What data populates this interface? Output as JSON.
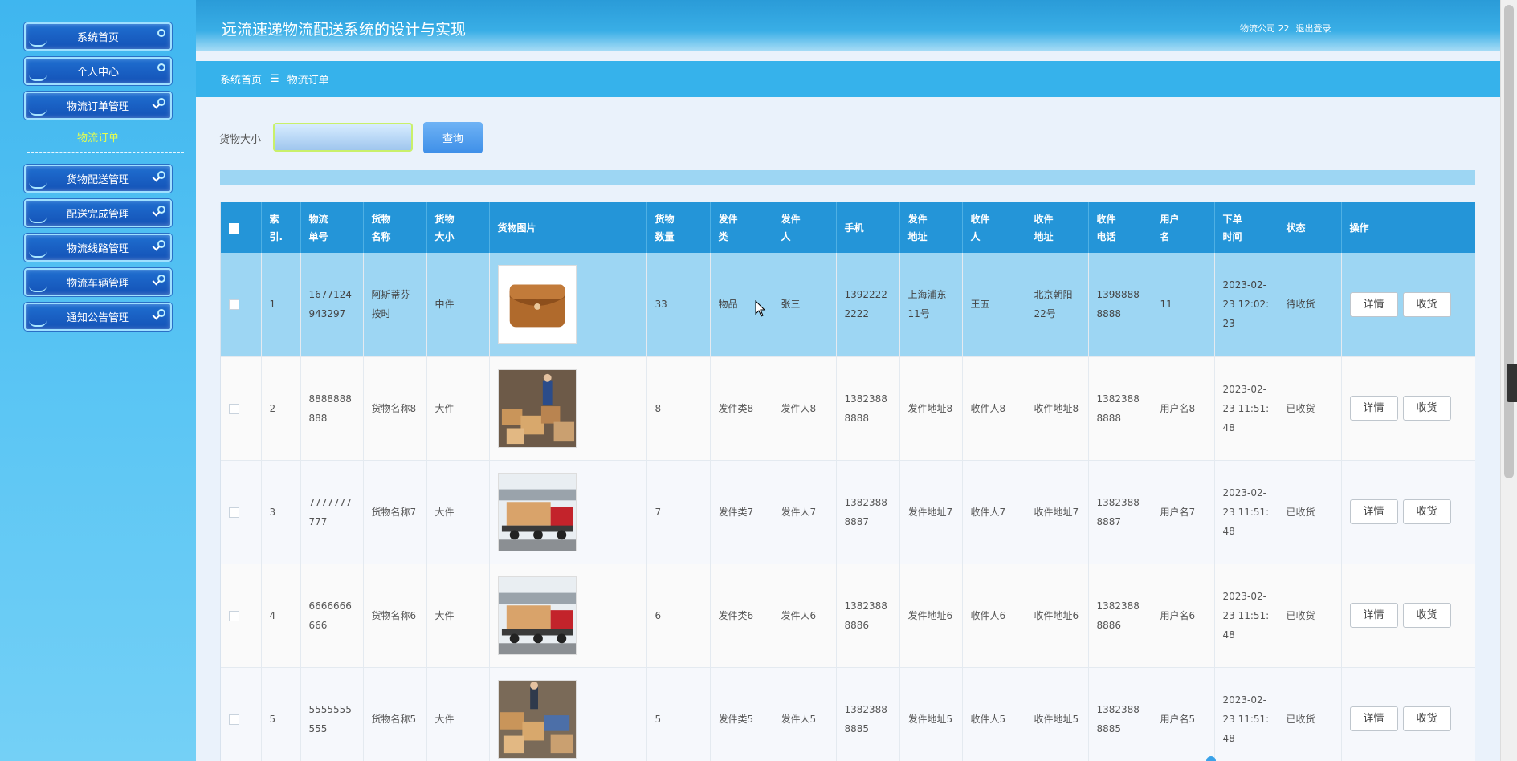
{
  "sidebar": {
    "items": [
      {
        "label": "系统首页"
      },
      {
        "label": "个人中心"
      },
      {
        "label": "物流订单管理"
      },
      {
        "label": "货物配送管理"
      },
      {
        "label": "配送完成管理"
      },
      {
        "label": "物流线路管理"
      },
      {
        "label": "物流车辆管理"
      },
      {
        "label": "通知公告管理"
      }
    ],
    "active_submenu": "物流订单"
  },
  "header": {
    "title": "远流速递物流配送系统的设计与实现",
    "user": "物流公司 22",
    "logout": "退出登录"
  },
  "breadcrumb": {
    "home": "系统首页",
    "separator": "☰",
    "current": "物流订单"
  },
  "search": {
    "label": "货物大小",
    "value": "",
    "button": "查询"
  },
  "table": {
    "headers": [
      "索引",
      "物流单号",
      "货物名称",
      "货物大小",
      "货物图片",
      "货物数量",
      "发件类",
      "发件人",
      "手机",
      "发件地址",
      "收件人",
      "收件地址",
      "收件电话",
      "用户名",
      "下单时间",
      "状态",
      "操作"
    ],
    "header_lines": [
      [
        "索",
        "引."
      ],
      [
        "物流",
        "单号"
      ],
      [
        "货物",
        "名称"
      ],
      [
        "货物",
        "大小"
      ],
      [
        "货物图片"
      ],
      [
        "货物",
        "数量"
      ],
      [
        "发件",
        "类"
      ],
      [
        "发件",
        "人"
      ],
      [
        "手机"
      ],
      [
        "发件",
        "地址"
      ],
      [
        "收件",
        "人"
      ],
      [
        "收件",
        "地址"
      ],
      [
        "收件",
        "电话"
      ],
      [
        "用户",
        "名"
      ],
      [
        "下单",
        "时间"
      ],
      [
        "状态"
      ],
      [
        "操作"
      ]
    ],
    "detail_label": "详情",
    "receive_label": "收货",
    "rows": [
      {
        "index": "1",
        "order_no": "1677124943297",
        "name": "阿斯蒂芬按时",
        "size": "中件",
        "image": "bag-photo",
        "qty": "33",
        "type": "物品",
        "sender": "张三",
        "phone": "13922222222",
        "send_addr": "上海浦东11号",
        "receiver": "王五",
        "recv_addr": "北京朝阳22号",
        "recv_phone": "13988888888",
        "username": "11",
        "time": "2023-02-23 12:02:23",
        "status": "待收货"
      },
      {
        "index": "2",
        "order_no": "8888888888",
        "name": "货物名称8",
        "size": "大件",
        "image": "parcels-photo",
        "qty": "8",
        "type": "发件类8",
        "sender": "发件人8",
        "phone": "13823888888",
        "send_addr": "发件地址8",
        "receiver": "收件人8",
        "recv_addr": "收件地址8",
        "recv_phone": "13823888888",
        "username": "用户名8",
        "time": "2023-02-23 11:51:48",
        "status": "已收货"
      },
      {
        "index": "3",
        "order_no": "7777777777",
        "name": "货物名称7",
        "size": "大件",
        "image": "truck-photo",
        "qty": "7",
        "type": "发件类7",
        "sender": "发件人7",
        "phone": "13823888887",
        "send_addr": "发件地址7",
        "receiver": "收件人7",
        "recv_addr": "收件地址7",
        "recv_phone": "13823888887",
        "username": "用户名7",
        "time": "2023-02-23 11:51:48",
        "status": "已收货"
      },
      {
        "index": "4",
        "order_no": "6666666666",
        "name": "货物名称6",
        "size": "大件",
        "image": "truck-photo",
        "qty": "6",
        "type": "发件类6",
        "sender": "发件人6",
        "phone": "13823888886",
        "send_addr": "发件地址6",
        "receiver": "收件人6",
        "recv_addr": "收件地址6",
        "recv_phone": "13823888886",
        "username": "用户名6",
        "time": "2023-02-23 11:51:48",
        "status": "已收货"
      },
      {
        "index": "5",
        "order_no": "5555555555",
        "name": "货物名称5",
        "size": "大件",
        "image": "parcels-photo",
        "qty": "5",
        "type": "发件类5",
        "sender": "发件人5",
        "phone": "13823888885",
        "send_addr": "发件地址5",
        "receiver": "收件人5",
        "recv_addr": "收件地址5",
        "recv_phone": "13823888885",
        "username": "用户名5",
        "time": "2023-02-23 11:51:48",
        "status": "已收货"
      }
    ]
  },
  "colors": {
    "sidebar": "#3fb6ef",
    "header": "#2a9bd8",
    "table_header": "#2495d8",
    "selected_row": "#9dd6f3",
    "submenu_active": "#e9ff4a"
  }
}
